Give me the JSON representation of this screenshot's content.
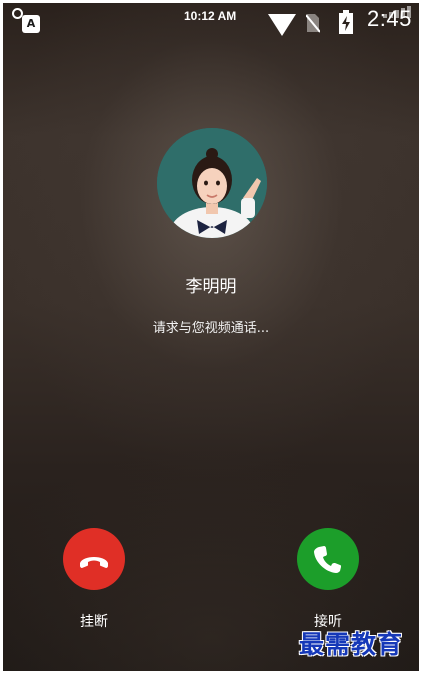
{
  "status_bar": {
    "time_small": "10:12 AM",
    "time_big": "2:45",
    "notification_badge": "A",
    "icons": [
      "notification-a-icon",
      "wifi-icon",
      "no-sim-icon",
      "battery-charging-icon",
      "signal-icon"
    ]
  },
  "caller": {
    "name": "李明明",
    "status": "请求与您视频通话..."
  },
  "actions": {
    "decline_label": "挂断",
    "answer_label": "接听",
    "decline_color": "#e02f26",
    "answer_color": "#1c9e2a"
  },
  "watermark": "最需教育"
}
